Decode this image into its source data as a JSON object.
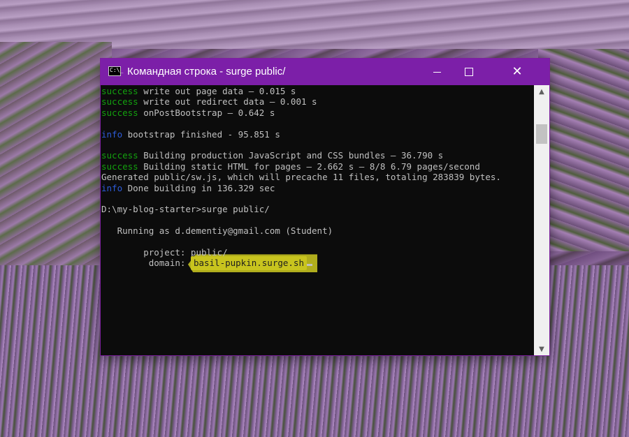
{
  "window": {
    "title": "Командная строка - surge  public/",
    "icon_text": "C:\\_",
    "controls": {
      "minimize": "minimize-icon",
      "maximize": "maximize-icon",
      "close": "✕"
    }
  },
  "console": {
    "lines": [
      {
        "tag": "success",
        "text": " write out page data — 0.015 s"
      },
      {
        "tag": "success",
        "text": " write out redirect data — 0.001 s"
      },
      {
        "tag": "success",
        "text": " onPostBootstrap — 0.642 s"
      },
      {
        "tag": "",
        "text": ""
      },
      {
        "tag": "info",
        "text": " bootstrap finished - 95.851 s"
      },
      {
        "tag": "",
        "text": ""
      },
      {
        "tag": "success",
        "text": " Building production JavaScript and CSS bundles — 36.790 s"
      },
      {
        "tag": "success",
        "text": " Building static HTML for pages — 2.662 s — 8/8 6.79 pages/second"
      },
      {
        "tag": "",
        "text": "Generated public/sw.js, which will precache 11 files, totaling 283839 bytes."
      },
      {
        "tag": "info",
        "text": " Done building in 136.329 sec"
      },
      {
        "tag": "",
        "text": ""
      },
      {
        "tag": "",
        "text": "D:\\my-blog-starter>surge public/"
      },
      {
        "tag": "",
        "text": ""
      },
      {
        "tag": "",
        "text": "   Running as d.dementiy@gmail.com (Student)"
      },
      {
        "tag": "",
        "text": ""
      },
      {
        "tag": "",
        "text": "        project: public/"
      },
      {
        "tag": "",
        "text": "         domain: "
      }
    ],
    "domain_value": "basil-pupkin.surge.sh"
  },
  "colors": {
    "titlebar": "#7c1fa8",
    "success": "#13a10e",
    "info": "#2d5bd8",
    "highlight": "#c8c41e"
  }
}
